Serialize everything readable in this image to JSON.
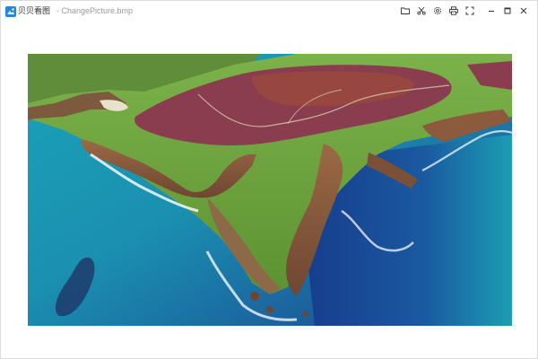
{
  "window": {
    "app_name": "贝贝看图",
    "file_title": "- ChangePicture.bmp"
  },
  "toolbar": {
    "icons": [
      "folder-icon",
      "scissors-icon",
      "settings-icon",
      "print-icon",
      "fullscreen-icon",
      "minimize-icon",
      "maximize-icon",
      "close-icon"
    ]
  },
  "colors": {
    "accent": "#1e88e5",
    "ocean_deep": "#1b3f8f",
    "ocean_teal": "#1aa3b8",
    "land_green": "#6fa83a",
    "heather": "#8a3d4f",
    "cliff": "#8c5a3c"
  },
  "image": {
    "name": "aerial-coastline-photo"
  }
}
